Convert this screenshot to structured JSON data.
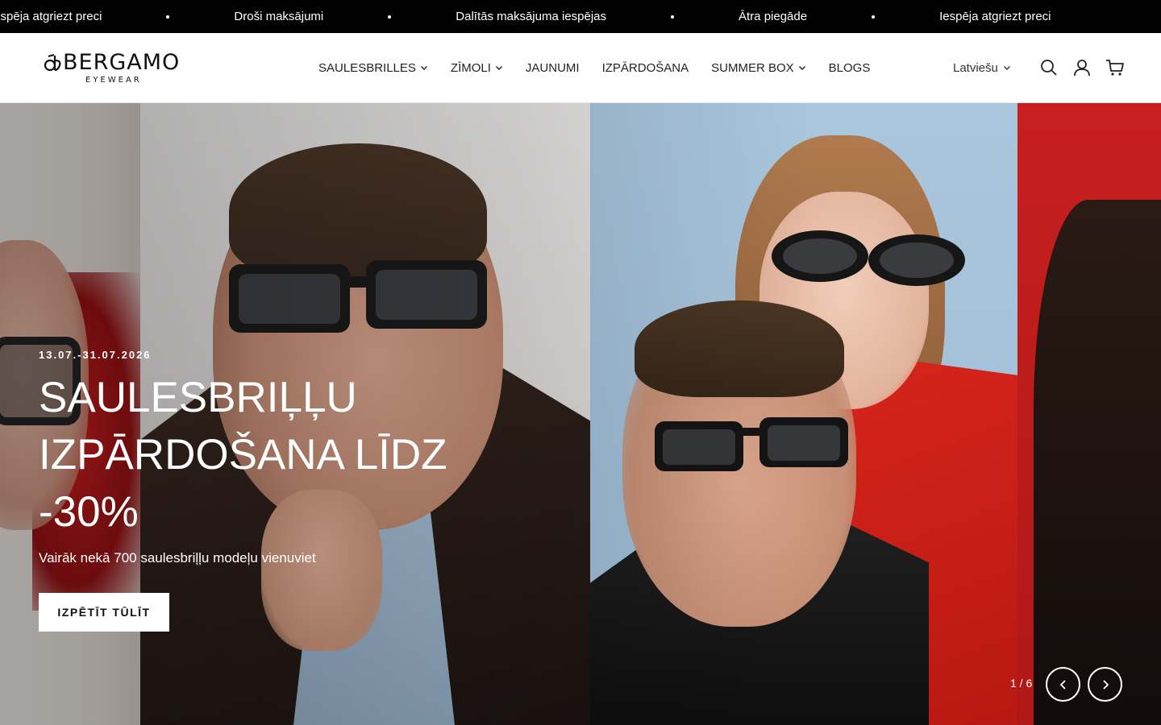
{
  "announcement": {
    "items": [
      "Iespēja atgriezt preci",
      "Droši maksājumi",
      "Dalītās maksājuma iespējas",
      "Ātra piegāde",
      "Iespēja atgriezt preci"
    ]
  },
  "header": {
    "logo": {
      "name": "BERGAMO",
      "tagline": "EYEWEAR"
    },
    "nav": [
      {
        "label": "SAULESBRILLES",
        "has_dropdown": true,
        "icon": "chevron-down-icon"
      },
      {
        "label": "ZĪMOLI",
        "has_dropdown": true,
        "icon": "chevron-down-icon"
      },
      {
        "label": "JAUNUMI",
        "has_dropdown": false
      },
      {
        "label": "IZPĀRDOŠANA",
        "has_dropdown": false
      },
      {
        "label": "SUMMER BOX",
        "has_dropdown": true,
        "icon": "chevron-down-icon"
      },
      {
        "label": "BLOGS",
        "has_dropdown": false
      }
    ],
    "language": "Latviešu",
    "icons": [
      "search-icon",
      "account-icon",
      "cart-icon"
    ]
  },
  "hero": {
    "date": "13.07.-31.07.2026",
    "title_lines": [
      "SAULESBRIĻĻU",
      "IZPĀRDOŠANA LĪDZ",
      "-30%"
    ],
    "subtitle": "Vairāk nekā 700 saulesbriļļu modeļu vienuviet",
    "button_label": "IZPĒTĪT TŪLĪT",
    "slide_counter": "1 / 6",
    "controls": [
      "arrow-left-icon",
      "arrow-right-icon"
    ]
  },
  "colors": {
    "announcement_bg": "#000000",
    "text": "#111111",
    "button_bg": "#ffffff",
    "hero_red": "#c71f1f",
    "hero_blue": "#a9c6dd"
  }
}
